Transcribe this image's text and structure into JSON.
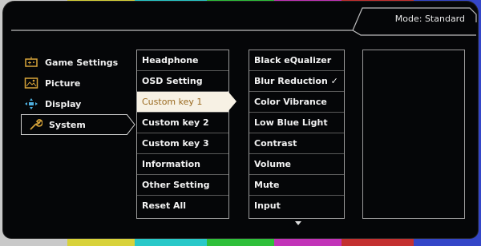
{
  "header": {
    "mode_label": "Mode: Standard"
  },
  "categories": [
    {
      "label": "Game Settings",
      "icon": "gamepad-icon"
    },
    {
      "label": "Picture",
      "icon": "picture-icon"
    },
    {
      "label": "Display",
      "icon": "display-icon"
    },
    {
      "label": "System",
      "icon": "wrench-icon",
      "selected": true
    }
  ],
  "submenu": [
    {
      "label": "Headphone"
    },
    {
      "label": "OSD Setting"
    },
    {
      "label": "Custom key 1",
      "selected": true
    },
    {
      "label": "Custom key 2"
    },
    {
      "label": "Custom key 3"
    },
    {
      "label": "Information"
    },
    {
      "label": "Other Setting"
    },
    {
      "label": "Reset All"
    }
  ],
  "options": [
    {
      "label": "Black eQualizer"
    },
    {
      "label": "Blur Reduction ✓"
    },
    {
      "label": "Color Vibrance"
    },
    {
      "label": "Low Blue Light"
    },
    {
      "label": "Contrast"
    },
    {
      "label": "Volume"
    },
    {
      "label": "Mute"
    },
    {
      "label": "Input"
    }
  ],
  "colors": {
    "accent": "#d9a53a",
    "highlight_bg": "#f7f1e4",
    "highlight_text": "#9a6a20"
  }
}
